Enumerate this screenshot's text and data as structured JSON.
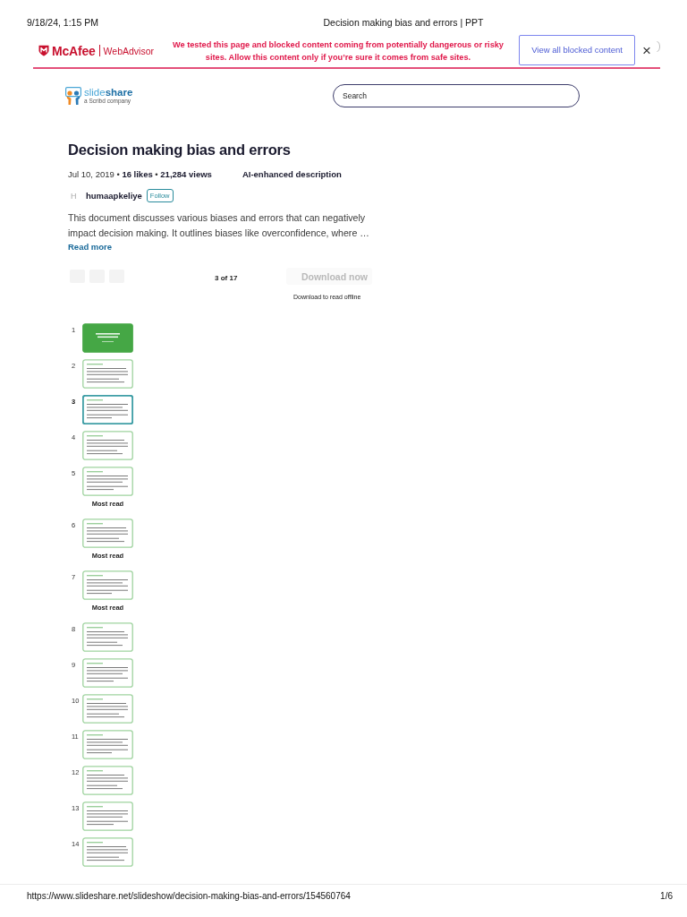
{
  "print_header": {
    "date_time": "9/18/24, 1:15 PM",
    "page_title": "Decision making bias and errors | PPT"
  },
  "security_banner": {
    "brand": "McAfee",
    "product": "WebAdvisor",
    "message": "We tested this page and blocked content coming from potentially dangerous or risky sites. Allow this content only if you’re sure it comes from safe sites.",
    "button": "View all blocked content",
    "close": "×"
  },
  "site_header": {
    "wordmark": "slide**share**",
    "tagline": "a Scribd company",
    "search": {
      "placeholder": "Search"
    }
  },
  "document": {
    "title": "Decision making bias and errors",
    "meta": "Jul 10, 2019 • **16 likes** • **21,284 views**",
    "ai_label": "AI-enhanced description",
    "author": {
      "initial": "H",
      "name": "humaapkeliye",
      "follow": "Follow"
    },
    "description": "This document discusses various biases and errors that can negatively impact decision making. It outlines biases like overconfidence, where …",
    "read_more": "Read more"
  },
  "viewer": {
    "page_indicator": "3 of 17",
    "download_button": "Download now",
    "download_note": "Download to read offline"
  },
  "slides": [
    {
      "number": "1",
      "kind": "title",
      "selected": false
    },
    {
      "number": "2",
      "kind": "content",
      "selected": false
    },
    {
      "number": "3",
      "kind": "content",
      "selected": true
    },
    {
      "number": "4",
      "kind": "content",
      "selected": false
    },
    {
      "number": "5",
      "kind": "content",
      "selected": false,
      "label": "Most read"
    },
    {
      "number": "6",
      "kind": "content",
      "selected": false,
      "label": "Most read"
    },
    {
      "number": "7",
      "kind": "content",
      "selected": false,
      "label": "Most read"
    },
    {
      "number": "8",
      "kind": "content",
      "selected": false
    },
    {
      "number": "9",
      "kind": "content",
      "selected": false
    },
    {
      "number": "10",
      "kind": "content",
      "selected": false
    },
    {
      "number": "11",
      "kind": "content",
      "selected": false
    },
    {
      "number": "12",
      "kind": "content",
      "selected": false
    },
    {
      "number": "13",
      "kind": "content",
      "selected": false
    },
    {
      "number": "14",
      "kind": "content",
      "selected": false
    }
  ],
  "print_footer": {
    "url": "https://www.slideshare.net/slideshow/decision-making-bias-and-errors/154560764",
    "page": "1/6"
  }
}
